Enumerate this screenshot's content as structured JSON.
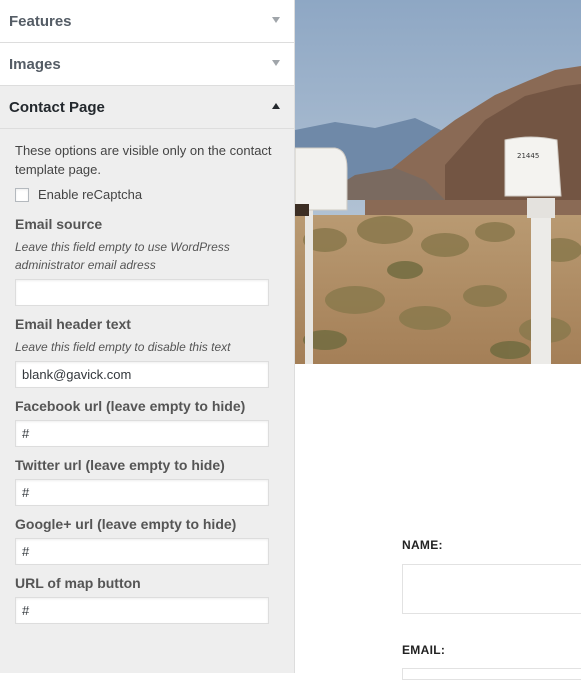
{
  "sidebar": {
    "sections": {
      "features": {
        "label": "Features"
      },
      "images": {
        "label": "Images"
      },
      "contact": {
        "label": "Contact Page"
      }
    },
    "contact_panel": {
      "description": "These options are visible only on the contact template page.",
      "recaptcha_label": "Enable reCaptcha",
      "recaptcha_checked": false,
      "email_source": {
        "title": "Email source",
        "hint": "Leave this field empty to use WordPress administrator email adress",
        "value": ""
      },
      "email_header": {
        "title": "Email header text",
        "hint": "Leave this field empty to disable this text",
        "value": "blank@gavick.com"
      },
      "facebook": {
        "title": "Facebook url (leave empty to hide)",
        "value": "#"
      },
      "twitter": {
        "title": "Twitter url (leave empty to hide)",
        "value": "#"
      },
      "googleplus": {
        "title": "Google+ url (leave empty to hide)",
        "value": "#"
      },
      "map_button": {
        "title": "URL of map button",
        "value": "#"
      }
    }
  },
  "preview": {
    "mailbox_number": "21445",
    "name_label": "NAME:",
    "email_label": "EMAIL:"
  },
  "colors": {
    "sidebar_bg": "#eeeeee",
    "border": "#dddddd",
    "text": "#23282d",
    "muted": "#555d66"
  }
}
